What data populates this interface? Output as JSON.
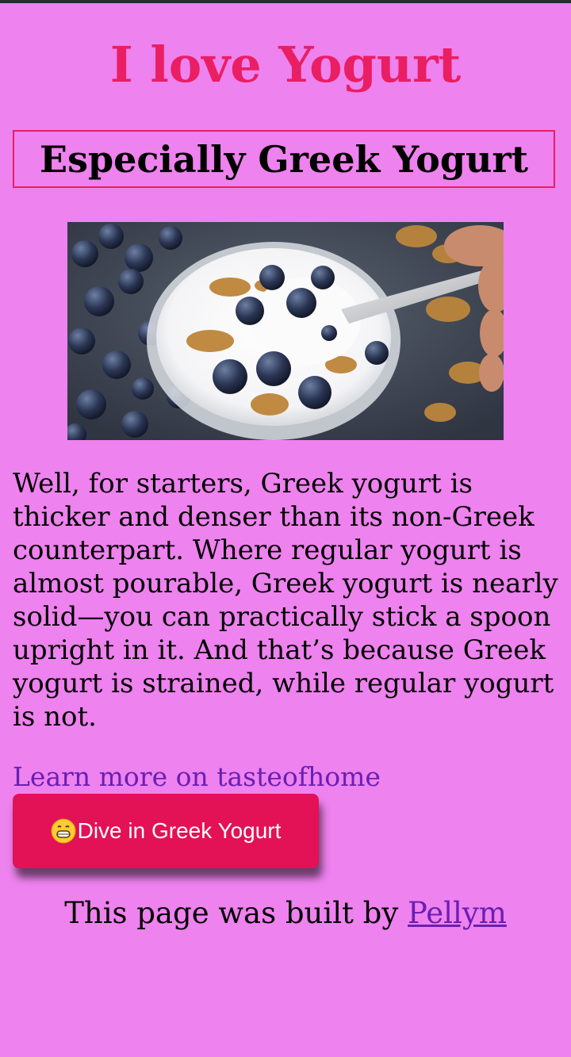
{
  "colors": {
    "background": "#ee82ee",
    "title": "#e91e63",
    "box_border": "#e91e63",
    "link": "#6a1fb2",
    "button_bg": "#e31155",
    "button_text": "#ffffff"
  },
  "header": {
    "title": "I love Yogurt",
    "subtitle": "Especially Greek Yogurt"
  },
  "image": {
    "icon": "greek-yogurt-with-blueberries-and-walnuts"
  },
  "content": {
    "paragraph": "Well, for starters, Greek yogurt is thicker and denser than its non-Greek counterpart. Where regular yogurt is almost pourable, Greek yogurt is nearly solid—you can practically stick a spoon upright in it. And that’s because Greek yogurt is strained, while regular yogurt is not.",
    "learn_more_link": "Learn more on tasteofhome"
  },
  "button": {
    "icon": "grinning-face-emoji",
    "label": "Dive in Greek Yogurt"
  },
  "footer": {
    "prefix": "This page was built by ",
    "author_link": "Pellym"
  }
}
